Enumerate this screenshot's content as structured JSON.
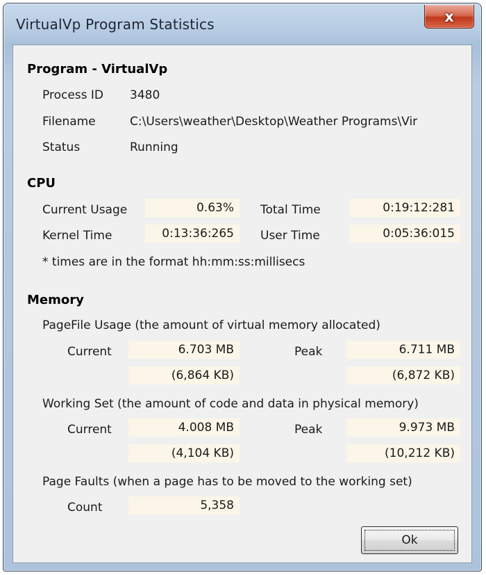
{
  "window": {
    "title": "VirtualVp Program Statistics",
    "close_glyph": "x"
  },
  "program": {
    "heading": "Program - VirtualVp",
    "process_id_label": "Process ID",
    "process_id_value": "3480",
    "filename_label": "Filename",
    "filename_value": "C:\\Users\\weather\\Desktop\\Weather Programs\\Vir",
    "status_label": "Status",
    "status_value": "Running"
  },
  "cpu": {
    "heading": "CPU",
    "current_usage_label": "Current Usage",
    "current_usage_value": "0.63%",
    "total_time_label": "Total Time",
    "total_time_value": "0:19:12:281",
    "kernel_time_label": "Kernel Time",
    "kernel_time_value": "0:13:36:265",
    "user_time_label": "User Time",
    "user_time_value": "0:05:36:015",
    "note": "* times are in the format hh:mm:ss:millisecs"
  },
  "memory": {
    "heading": "Memory",
    "pagefile": {
      "description": "PageFile Usage (the amount of virtual memory allocated)",
      "current_label": "Current",
      "current_mb": "6.703 MB",
      "current_kb": "(6,864 KB)",
      "peak_label": "Peak",
      "peak_mb": "6.711 MB",
      "peak_kb": "(6,872 KB)"
    },
    "working_set": {
      "description": "Working Set (the amount of code and data in physical memory)",
      "current_label": "Current",
      "current_mb": "4.008 MB",
      "current_kb": "(4,104 KB)",
      "peak_label": "Peak",
      "peak_mb": "9.973 MB",
      "peak_kb": "(10,212 KB)"
    },
    "page_faults": {
      "description": "Page Faults (when a page has to be moved to the working set)",
      "count_label": "Count",
      "count_value": "5,358"
    }
  },
  "buttons": {
    "ok_label": "Ok"
  },
  "colors": {
    "field_bg": "#fbf6e8",
    "dialog_bg": "#f0f0f0",
    "close_red": "#c0391d"
  }
}
